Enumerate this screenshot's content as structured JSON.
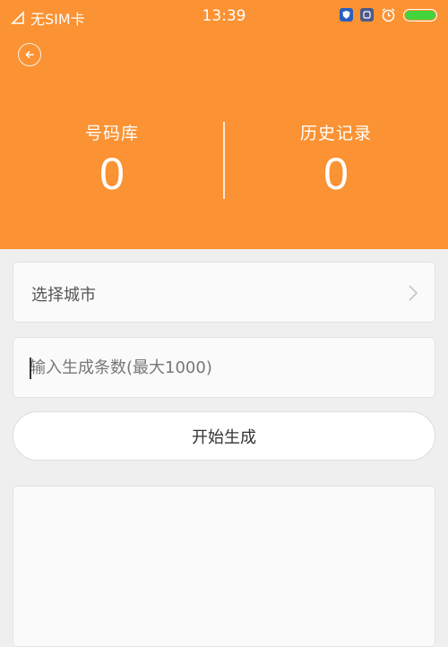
{
  "status_bar": {
    "carrier": "无SIM卡",
    "time": "13:39",
    "battery_level": 1.0,
    "battery_color": "#43d43c"
  },
  "header": {
    "background_color": "#fb9233",
    "stats": [
      {
        "label": "号码库",
        "value": "0"
      },
      {
        "label": "历史记录",
        "value": "0"
      }
    ]
  },
  "form": {
    "city_select_label": "选择城市",
    "count_placeholder": "输入生成条数(最大1000)",
    "count_value": "",
    "start_button_label": "开始生成"
  },
  "icons": {
    "back": "back-arrow-circle-icon",
    "chevron": "chevron-right-icon"
  }
}
